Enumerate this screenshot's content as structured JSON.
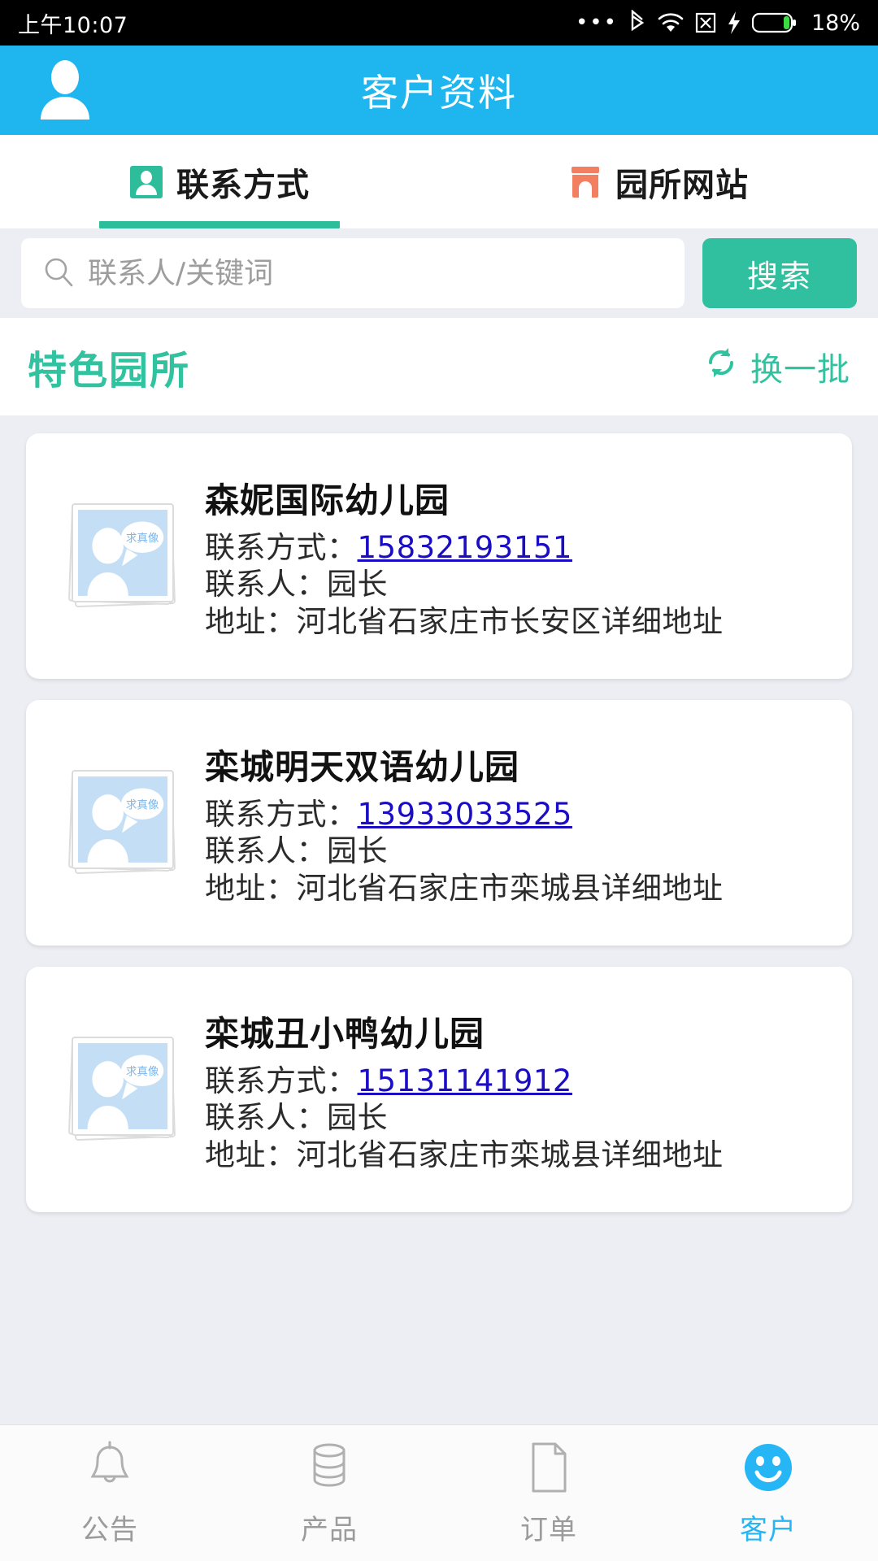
{
  "statusbar": {
    "time": "上午10:07",
    "battery_percent": "18%",
    "icons": [
      "more-dots-icon",
      "bluetooth-icon",
      "wifi-icon",
      "sim-x-icon",
      "charging-bolt-icon",
      "battery-icon"
    ]
  },
  "header": {
    "title": "客户资料",
    "user_icon": "person-icon",
    "background_color": "#1fb6f0"
  },
  "tabs": {
    "active_index": 0,
    "items": [
      {
        "label": "联系方式",
        "icon": "contact-card-icon",
        "icon_color": "#2ebd9a",
        "active": true
      },
      {
        "label": "园所网站",
        "icon": "shop-icon",
        "icon_color": "#f37f63",
        "active": false
      }
    ],
    "indicator_color": "#2ebd9a"
  },
  "search": {
    "placeholder": "联系人/关键词",
    "value": "",
    "icon": "search-icon",
    "button_label": "搜索",
    "button_color": "#30bf9f"
  },
  "section": {
    "title": "特色园所",
    "title_color": "#31c29f",
    "refresh_label": "换一批",
    "refresh_icon": "refresh-icon"
  },
  "list": {
    "cards": [
      {
        "title": "森妮国际幼儿园",
        "contact_label": "联系方式：",
        "phone": "15832193151",
        "person_label": "联系人：",
        "person": "园长",
        "address_label": "地址：",
        "address": "河北省石家庄市长安区详细地址",
        "thumbnail": {
          "icon": "photo-placeholder-icon",
          "caption": "求真像",
          "bg_color": "#c4dff5"
        }
      },
      {
        "title": "栾城明天双语幼儿园",
        "contact_label": "联系方式：",
        "phone": "13933033525",
        "person_label": "联系人：",
        "person": "园长",
        "address_label": "地址：",
        "address": "河北省石家庄市栾城县详细地址",
        "thumbnail": {
          "icon": "photo-placeholder-icon",
          "caption": "求真像",
          "bg_color": "#c4dff5"
        }
      },
      {
        "title": "栾城丑小鸭幼儿园",
        "contact_label": "联系方式：",
        "phone": "15131141912",
        "person_label": "联系人：",
        "person": "园长",
        "address_label": "地址：",
        "address": "河北省石家庄市栾城县详细地址",
        "thumbnail": {
          "icon": "photo-placeholder-icon",
          "caption": "求真像",
          "bg_color": "#c4dff5"
        }
      }
    ]
  },
  "bottomnav": {
    "active_index": 3,
    "active_color": "#26b6f5",
    "items": [
      {
        "label": "公告",
        "icon": "bell-icon"
      },
      {
        "label": "产品",
        "icon": "database-icon"
      },
      {
        "label": "订单",
        "icon": "document-icon"
      },
      {
        "label": "客户",
        "icon": "smiley-icon"
      }
    ]
  }
}
